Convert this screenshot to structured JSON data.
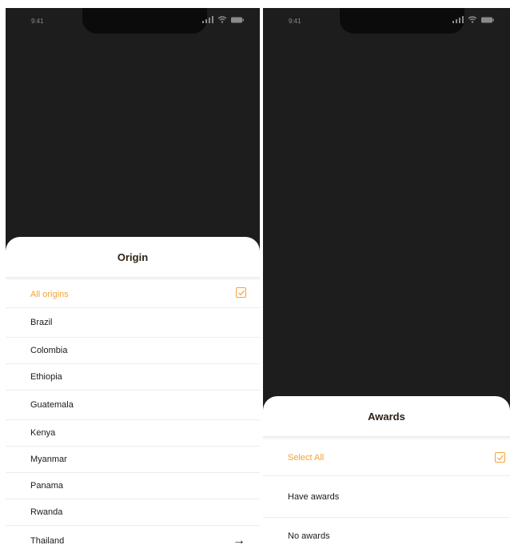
{
  "status_bar": {
    "time": "9:41"
  },
  "origin_sheet": {
    "title": "Origin",
    "items": [
      {
        "label": "All origins",
        "selected": true
      },
      {
        "label": "Brazil"
      },
      {
        "label": "Colombia"
      },
      {
        "label": "Ethiopia"
      },
      {
        "label": "Guatemala"
      },
      {
        "label": "Kenya"
      },
      {
        "label": "Myanmar"
      },
      {
        "label": "Panama"
      },
      {
        "label": "Rwanda"
      },
      {
        "label": "Thailand",
        "icon": "arrow-right-icon"
      }
    ]
  },
  "awards_sheet": {
    "title": "Awards",
    "items": [
      {
        "label": "Select All",
        "selected": true
      },
      {
        "label": "Have awards"
      },
      {
        "label": "No awards"
      }
    ]
  },
  "colors": {
    "accent": "#f2a33a",
    "title_text": "#2e2113",
    "backdrop": "#1d1d1d"
  }
}
